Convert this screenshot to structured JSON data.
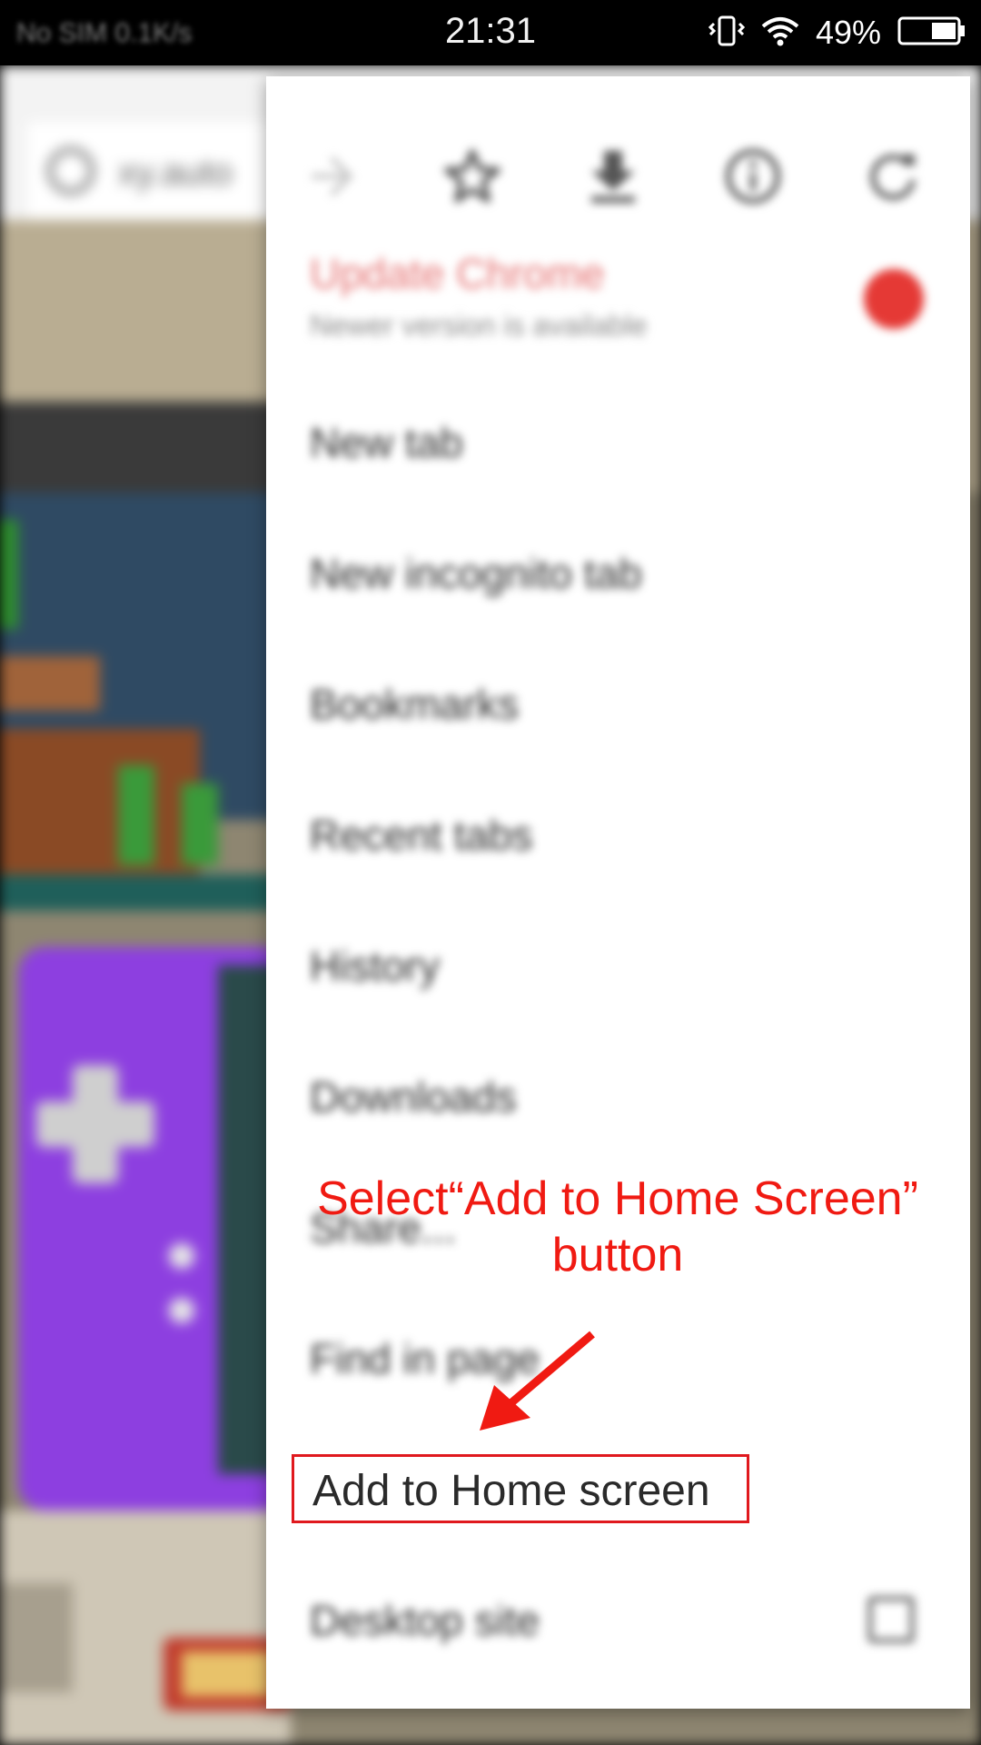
{
  "status_bar": {
    "carrier": "No SIM 0.1K/s",
    "time": "21:31",
    "battery": "49%",
    "icons": [
      "vibrate-icon",
      "wifi-icon",
      "battery-icon"
    ]
  },
  "address_bar": {
    "text": "xy.auto"
  },
  "menu": {
    "icons": [
      "forward-icon",
      "bookmark-star-icon",
      "download-icon",
      "info-icon",
      "refresh-icon"
    ],
    "update": {
      "title": "Update Chrome",
      "subtitle": "Newer version is available"
    },
    "items": [
      "New tab",
      "New incognito tab",
      "Bookmarks",
      "Recent tabs",
      "History",
      "Downloads",
      "Share...",
      "Find in page",
      "Add to Home screen",
      "Desktop site"
    ]
  },
  "annotation": {
    "line1": "Select“Add to Home Screen”",
    "line2": "button",
    "highlighted_item": "Add to Home screen",
    "color": "#f01a12"
  }
}
